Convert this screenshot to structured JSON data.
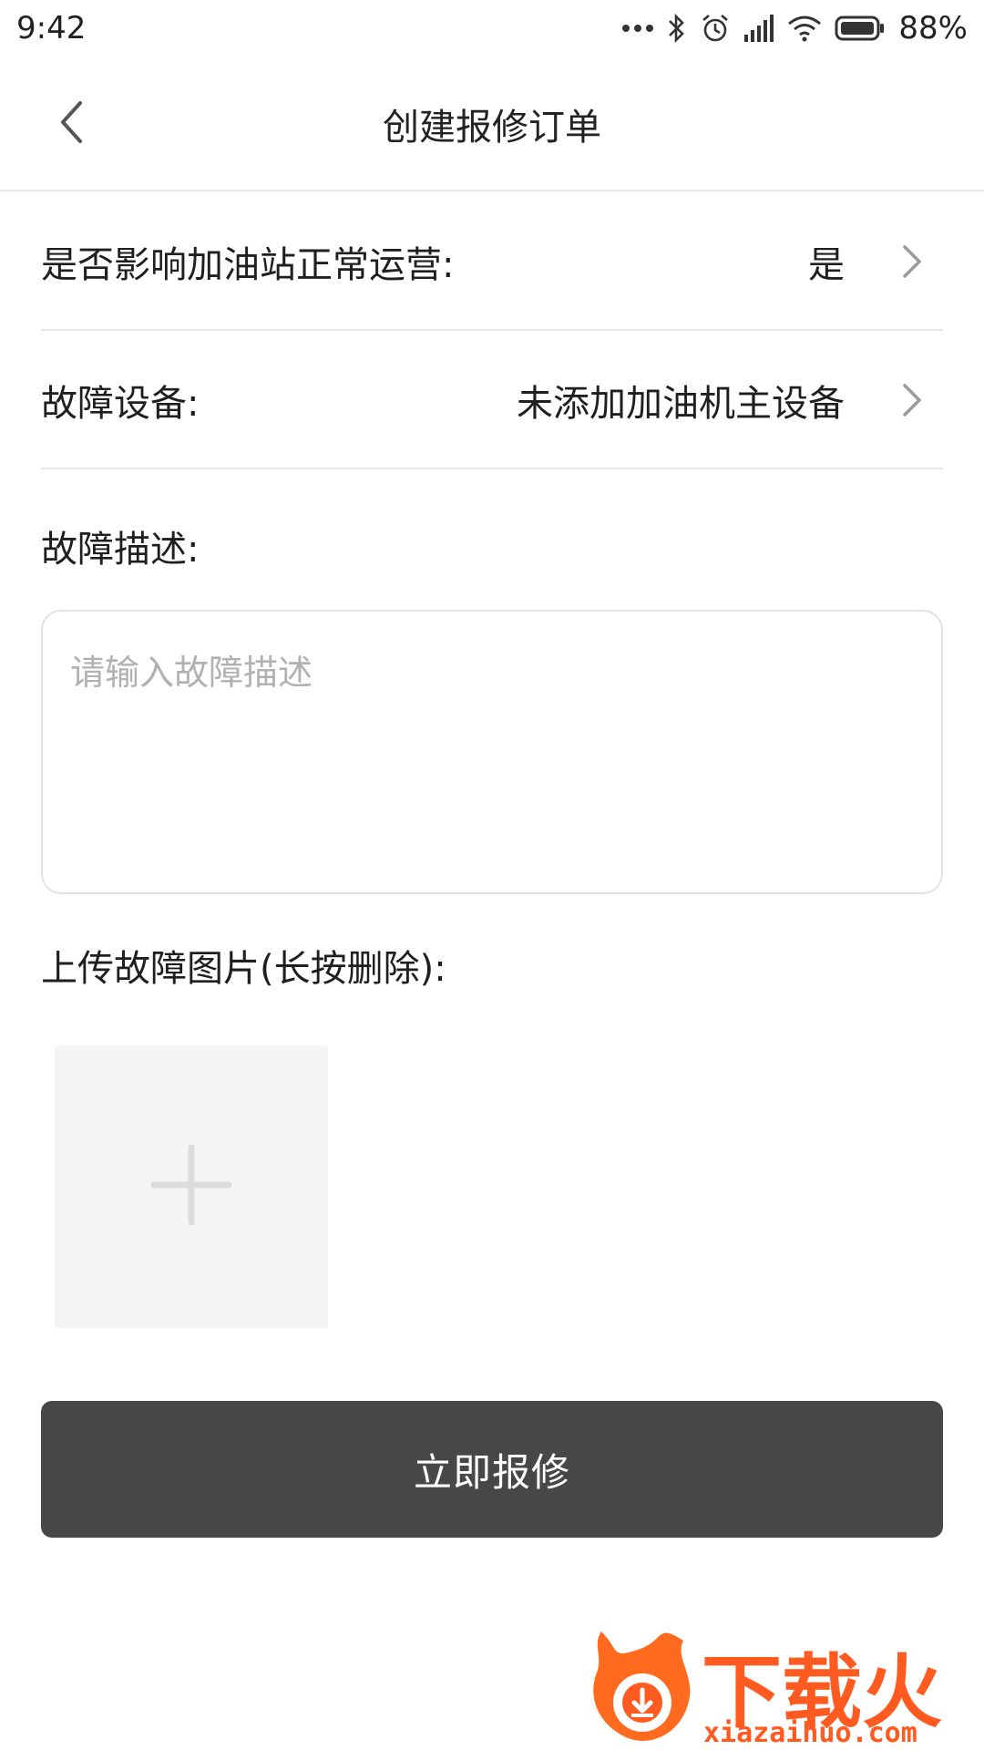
{
  "status_bar": {
    "time": "9:42",
    "battery_percent": "88%",
    "icons": [
      "more-dots-icon",
      "bluetooth-icon",
      "alarm-icon",
      "signal-icon",
      "wifi-icon",
      "battery-icon"
    ]
  },
  "header": {
    "title": "创建报修订单"
  },
  "form": {
    "affects_operation": {
      "label": "是否影响加油站正常运营:",
      "value": "是"
    },
    "fault_device": {
      "label": "故障设备:",
      "value": "未添加加油机主设备"
    },
    "fault_description": {
      "label": "故障描述:",
      "placeholder": "请输入故障描述",
      "value": ""
    },
    "upload_images": {
      "label": "上传故障图片(长按删除):"
    },
    "submit_label": "立即报修"
  },
  "watermark": {
    "brand": "下载火",
    "domain": "xiazaihuo.com"
  },
  "colors": {
    "button_bg": "#474747",
    "divider": "#e6e6e6",
    "placeholder": "#b1b1b1",
    "watermark": "#ff5a1f"
  }
}
